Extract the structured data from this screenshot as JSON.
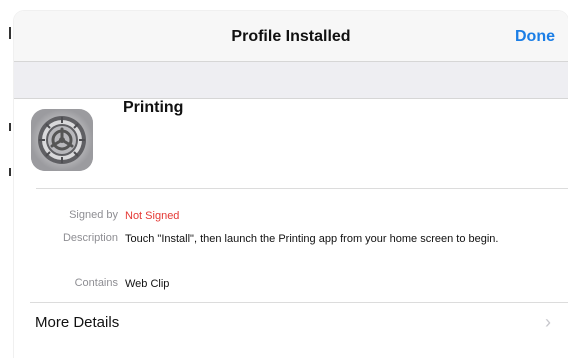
{
  "header": {
    "title": "Profile Installed",
    "done_label": "Done"
  },
  "profile": {
    "name": "Printing",
    "icon": "settings-gear-icon"
  },
  "details": {
    "signed_by_label": "Signed by",
    "signed_by_value": "Not Signed",
    "description_label": "Description",
    "description_value": "Touch \"Install\", then launch the Printing app from your home screen to begin.",
    "contains_label": "Contains",
    "contains_value": "Web Clip"
  },
  "more_details": {
    "label": "More Details",
    "chevron": "›"
  },
  "colors": {
    "accent": "#1b7ee6",
    "warning": "#e53935"
  }
}
